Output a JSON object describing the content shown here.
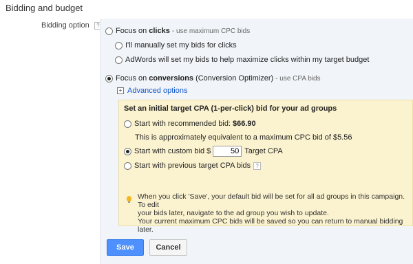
{
  "section": {
    "title": "Bidding and budget"
  },
  "bidding": {
    "label": "Bidding option",
    "help": "?",
    "clicks": {
      "prefix": "Focus on ",
      "emph": "clicks",
      "hint": " - use maximum CPC bids",
      "manual": "I'll manually set my bids for clicks",
      "auto": "AdWords will set my bids to help maximize clicks within my target budget"
    },
    "conversions": {
      "prefix": "Focus on ",
      "emph": "conversions",
      "suffix": " (Conversion Optimizer)",
      "hint": " - use CPA bids",
      "advanced": "Advanced options",
      "expander": "+"
    }
  },
  "cpa": {
    "heading": "Set an initial target CPA (1-per-click) bid for your ad groups",
    "recommended_label": "Start with recommended bid: ",
    "recommended_value": "$66.90",
    "approx": "This is approximately equivalent to a maximum CPC bid of $5.56",
    "custom_label": "Start with custom bid $",
    "custom_value": "50",
    "custom_suffix": "Target CPA",
    "previous": "Start with previous target CPA bids",
    "info_line1": "When you click 'Save', your default bid will be set for all ad groups in this campaign. To edit",
    "info_line2": "your bids later, navigate to the ad group you wish to update.",
    "info_line3": "Your current maximum CPC bids will be saved so you can return to manual bidding later."
  },
  "actions": {
    "save": "Save",
    "cancel": "Cancel"
  },
  "colors": {
    "save_button": "#4d90fe",
    "cpa_panel": "#fbf2cf",
    "link": "#1155cc",
    "bulb": "#f2b820"
  },
  "icons": {
    "help": "help-icon",
    "expand": "expand-icon",
    "info": "lightbulb-icon"
  }
}
